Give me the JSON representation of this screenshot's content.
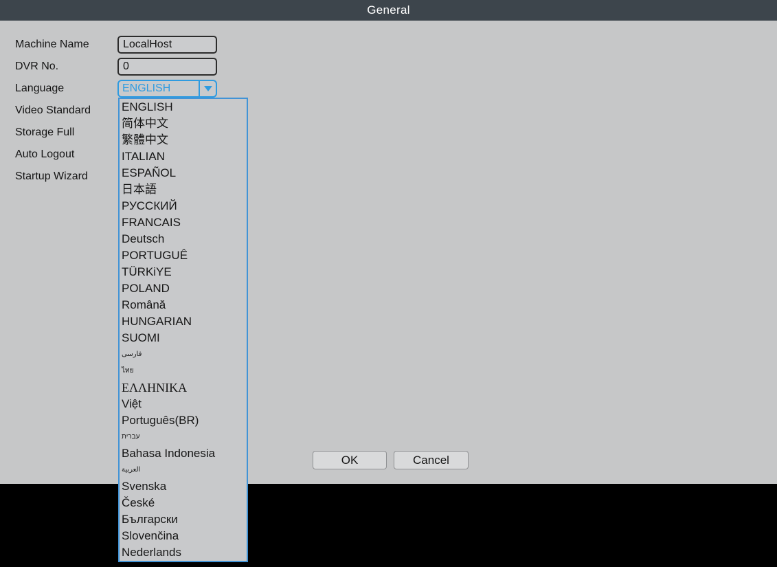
{
  "dialog": {
    "title": "General"
  },
  "form": {
    "rows": [
      {
        "label": "Machine Name"
      },
      {
        "label": "DVR No."
      },
      {
        "label": "Language"
      },
      {
        "label": "Video Standard"
      },
      {
        "label": "Storage Full"
      },
      {
        "label": "Auto Logout"
      },
      {
        "label": "Startup Wizard"
      }
    ],
    "machine_name_value": "LocalHost",
    "dvr_no_value": "0",
    "language_selected": "ENGLISH"
  },
  "language_dropdown": {
    "items": [
      {
        "label": "ENGLISH"
      },
      {
        "label": "简体中文"
      },
      {
        "label": "繁體中文"
      },
      {
        "label": "ITALIAN"
      },
      {
        "label": "ESPAÑOL"
      },
      {
        "label": "日本語"
      },
      {
        "label": "РУССКИЙ"
      },
      {
        "label": "FRANCAIS"
      },
      {
        "label": "Deutsch"
      },
      {
        "label": "PORTUGUÊ"
      },
      {
        "label": "TÜRKiYE"
      },
      {
        "label": "POLAND"
      },
      {
        "label": "Română"
      },
      {
        "label": "HUNGARIAN"
      },
      {
        "label": "SUOMI"
      },
      {
        "label": "فارسی",
        "small": true
      },
      {
        "label": "ไทย",
        "small": true
      },
      {
        "label": "ΕΛΛΗΝΙΚΑ",
        "serif": true
      },
      {
        "label": "Việt"
      },
      {
        "label": "Português(BR)"
      },
      {
        "label": "עברית",
        "small": true
      },
      {
        "label": "Bahasa Indonesia"
      },
      {
        "label": "العربية",
        "small": true
      },
      {
        "label": "Svenska"
      },
      {
        "label": "České"
      },
      {
        "label": "Български"
      },
      {
        "label": "Slovenčina"
      },
      {
        "label": "Nederlands"
      }
    ]
  },
  "buttons": {
    "ok": "OK",
    "cancel": "Cancel"
  },
  "colors": {
    "accent_blue": "#2f9be0",
    "titlebar_bg": "#3d454c",
    "dialog_bg": "#c6c7c8",
    "black_area": "#000000"
  }
}
